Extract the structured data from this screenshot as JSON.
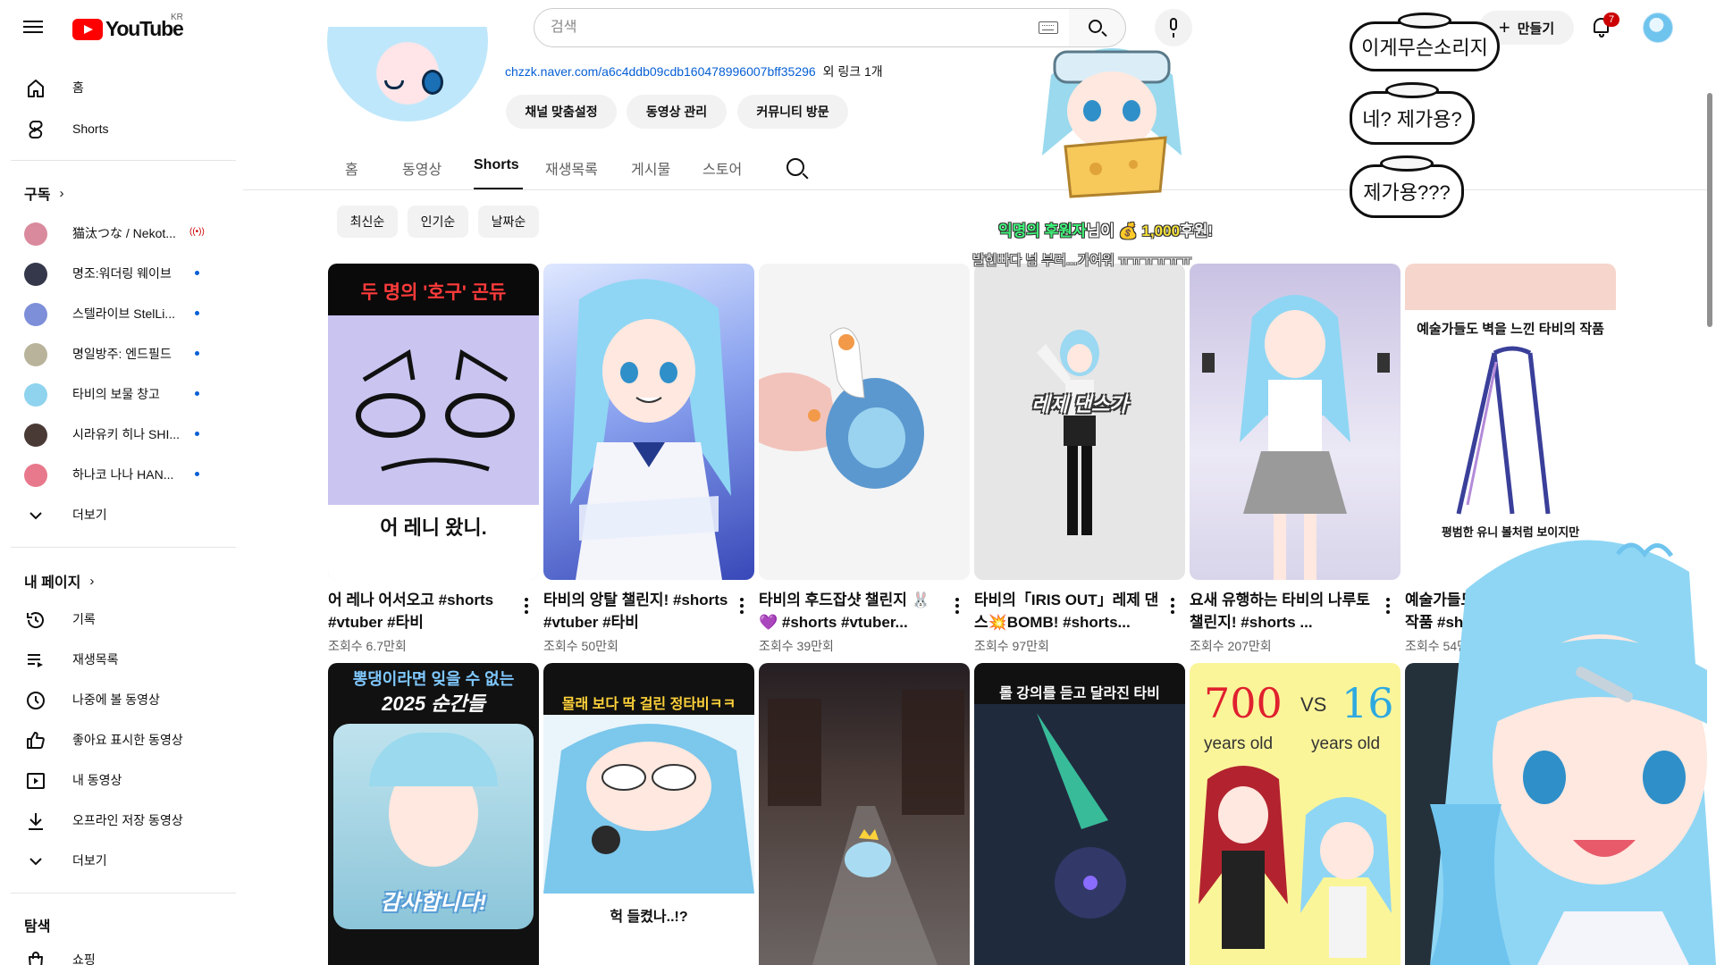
{
  "header": {
    "logo_text": "YouTube",
    "logo_region": "KR",
    "search_placeholder": "검색",
    "create_label": "만들기",
    "notification_count": "7"
  },
  "sidebar": {
    "main": [
      {
        "label": "홈",
        "icon": "home-icon"
      },
      {
        "label": "Shorts",
        "icon": "shorts-icon"
      }
    ],
    "subscriptions_title": "구독",
    "subscriptions": [
      {
        "label": "猫汰つな / Nekot...",
        "color": "#d98a9c",
        "live": true
      },
      {
        "label": "명조:워더링 웨이브",
        "color": "#34384a",
        "live": false
      },
      {
        "label": "스텔라이브 StelLi...",
        "color": "#7e8fd9",
        "live": false
      },
      {
        "label": "명일방주: 엔드필드",
        "color": "#b8b39a",
        "live": false
      },
      {
        "label": "타비의 보물 창고",
        "color": "#8fd3ee",
        "live": false
      },
      {
        "label": "시라유키 히나 SHI...",
        "color": "#4a3a36",
        "live": false
      },
      {
        "label": "하나코 나나 HAN...",
        "color": "#e8788c",
        "live": false
      }
    ],
    "subscriptions_more": "더보기",
    "you_title": "내 페이지",
    "you_items": [
      {
        "label": "기록",
        "icon": "history-icon"
      },
      {
        "label": "재생목록",
        "icon": "playlist-icon"
      },
      {
        "label": "나중에 볼 동영상",
        "icon": "watch-later-icon"
      },
      {
        "label": "좋아요 표시한 동영상",
        "icon": "like-icon"
      },
      {
        "label": "내 동영상",
        "icon": "my-videos-icon"
      },
      {
        "label": "오프라인 저장 동영상",
        "icon": "download-icon"
      }
    ],
    "you_more": "더보기",
    "explore_title": "탐색",
    "explore_items": [
      {
        "label": "쇼핑",
        "icon": "shopping-icon"
      }
    ]
  },
  "channel": {
    "link_url": "chzzk.naver.com/a6c4ddb09cdb160478996007bff35296",
    "link_more": "외 링크 1개",
    "buttons": [
      "채널 맞춤설정",
      "동영상 관리",
      "커뮤니티 방문"
    ],
    "tabs": [
      "홈",
      "동영상",
      "Shorts",
      "재생목록",
      "게시물",
      "스토어"
    ],
    "active_tab": "Shorts",
    "chips": [
      "최신순",
      "인기순",
      "날짜순"
    ]
  },
  "shorts": [
    {
      "title": "어 레나 어서오고 #shorts #vtuber #타비",
      "views": "조회수 6.7만회",
      "thumb_top": "두 명의 '호구' 곤듀",
      "thumb_bottom": "어 레니 왔니.",
      "bg": "#c9c4f0"
    },
    {
      "title": "타비의 앙탈 챌린지! #shorts #vtuber #타비",
      "views": "조회수 50만회",
      "thumb_top": "",
      "thumb_bottom": "",
      "bg": "#6a86e8"
    },
    {
      "title": "타비의 후드잡샷 챌린지 🐰 💜 #shorts #vtuber...",
      "views": "조회수 39만회",
      "thumb_top": "",
      "thumb_bottom": "",
      "bg": "#f4f4f4"
    },
    {
      "title": "타비의「IRIS OUT」레제 댄스💥BOMB! #shorts...",
      "views": "조회수 97만회",
      "thumb_top": "",
      "thumb_bottom": "레제 댄스가",
      "bg": "#e6e6e6"
    },
    {
      "title": "요새 유행하는 타비의 나루토 챌린지! #shorts ...",
      "views": "조회수 207만회",
      "thumb_top": "",
      "thumb_bottom": "",
      "bg": "#d9d6ea"
    },
    {
      "title": "예술가들도 벽을 느낀 타비의 작품 #shorts",
      "views": "조회수 54만회",
      "thumb_top": "예술가들도 벽을 느낀 타비의 작품",
      "thumb_bottom": "평범한 유니 볼처럼 보이지만",
      "bg": "#ffffff"
    },
    {
      "title": "",
      "views": "",
      "thumb_top": "뽕댕이라면 잊을 수 없는",
      "thumb_mid": "2025 순간들",
      "thumb_bottom": "감사합니다!",
      "bg": "#1a1a1a"
    },
    {
      "title": "",
      "views": "",
      "thumb_top": "몰래 보다 딱 걸린 정타비ㅋㅋ",
      "thumb_bottom": "헉 들켰나..!?",
      "bg": "#ffffff"
    },
    {
      "title": "",
      "views": "",
      "thumb_top": "",
      "thumb_bottom": "",
      "bg": "#3a2f2c"
    },
    {
      "title": "",
      "views": "",
      "thumb_top": "롤 강의를 듣고 달라진 타비",
      "thumb_bottom": "",
      "bg": "#1c2434"
    },
    {
      "title": "",
      "views": "",
      "thumb_top": "700",
      "thumb_mid": "VS",
      "thumb_right": "16",
      "thumb_bottom_left": "years old",
      "thumb_bottom_right": "years old",
      "bg": "#fbf59a"
    },
    {
      "title": "",
      "views": "",
      "thumb_top": "",
      "thumb_bottom": "",
      "bg": "#24303a"
    }
  ],
  "overlay": {
    "bubbles": [
      "이게무슨소리지",
      "네? 제가용?",
      "제가용???"
    ],
    "donation_name": "익명의 후원자",
    "donation_mid": "님이 💰",
    "donation_amount": "1,000",
    "donation_end": "후원!",
    "donation_message": "발힌빠다 넘 부러...가여워 ㅠㅠㅠㅠㅠㅠ"
  }
}
